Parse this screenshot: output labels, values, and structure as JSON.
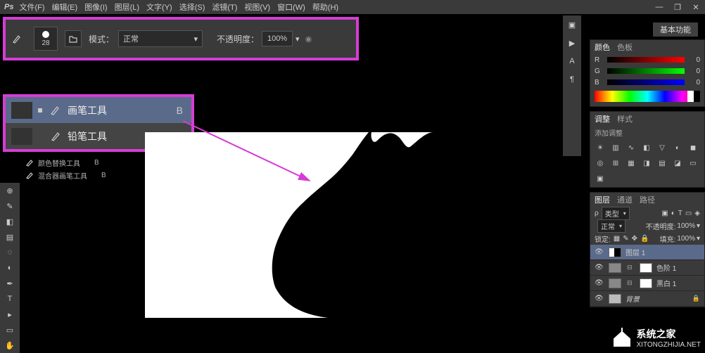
{
  "menu": {
    "ps": "Ps",
    "items": [
      "文件(F)",
      "编辑(E)",
      "图像(I)",
      "图层(L)",
      "文字(Y)",
      "选择(S)",
      "滤镜(T)",
      "视图(V)",
      "窗口(W)",
      "帮助(H)"
    ]
  },
  "basic_fn": "基本功能",
  "options": {
    "brush_size": "28",
    "mode_label": "模式：",
    "mode_value": "正常",
    "opacity_label": "不透明度：",
    "opacity_value": "100%"
  },
  "tool_flyout": {
    "items": [
      {
        "label": "画笔工具",
        "shortcut": "B",
        "selected": true
      },
      {
        "label": "铅笔工具",
        "shortcut": "B",
        "selected": false
      }
    ]
  },
  "extra_tools": [
    {
      "label": "颜色替换工具",
      "shortcut": "B"
    },
    {
      "label": "混合器画笔工具",
      "shortcut": "B"
    }
  ],
  "color_panel": {
    "tab_color": "颜色",
    "tab_swatch": "色板",
    "channels": [
      {
        "ch": "R",
        "val": "0"
      },
      {
        "ch": "G",
        "val": "0"
      },
      {
        "ch": "B",
        "val": "0"
      }
    ]
  },
  "adjust_panel": {
    "tab_adjust": "调整",
    "tab_style": "样式",
    "add_label": "添加调整"
  },
  "layers_panel": {
    "tab_layers": "图层",
    "tab_channels": "通道",
    "tab_paths": "路径",
    "kind_label": "类型",
    "blend": "正常",
    "opacity_label": "不透明度:",
    "opacity_val": "100%",
    "lock_label": "锁定:",
    "fill_label": "填充:",
    "fill_val": "100%",
    "layers": [
      {
        "name": "图层 1",
        "selected": true,
        "thumb": "cat"
      },
      {
        "name": "色阶 1",
        "selected": false,
        "thumb": "adj"
      },
      {
        "name": "黑白 1",
        "selected": false,
        "thumb": "adj"
      },
      {
        "name": "背景",
        "selected": false,
        "thumb": "bg"
      }
    ]
  },
  "watermark": {
    "title": "系统之家",
    "url": "XITONGZHIJIA.NET"
  }
}
